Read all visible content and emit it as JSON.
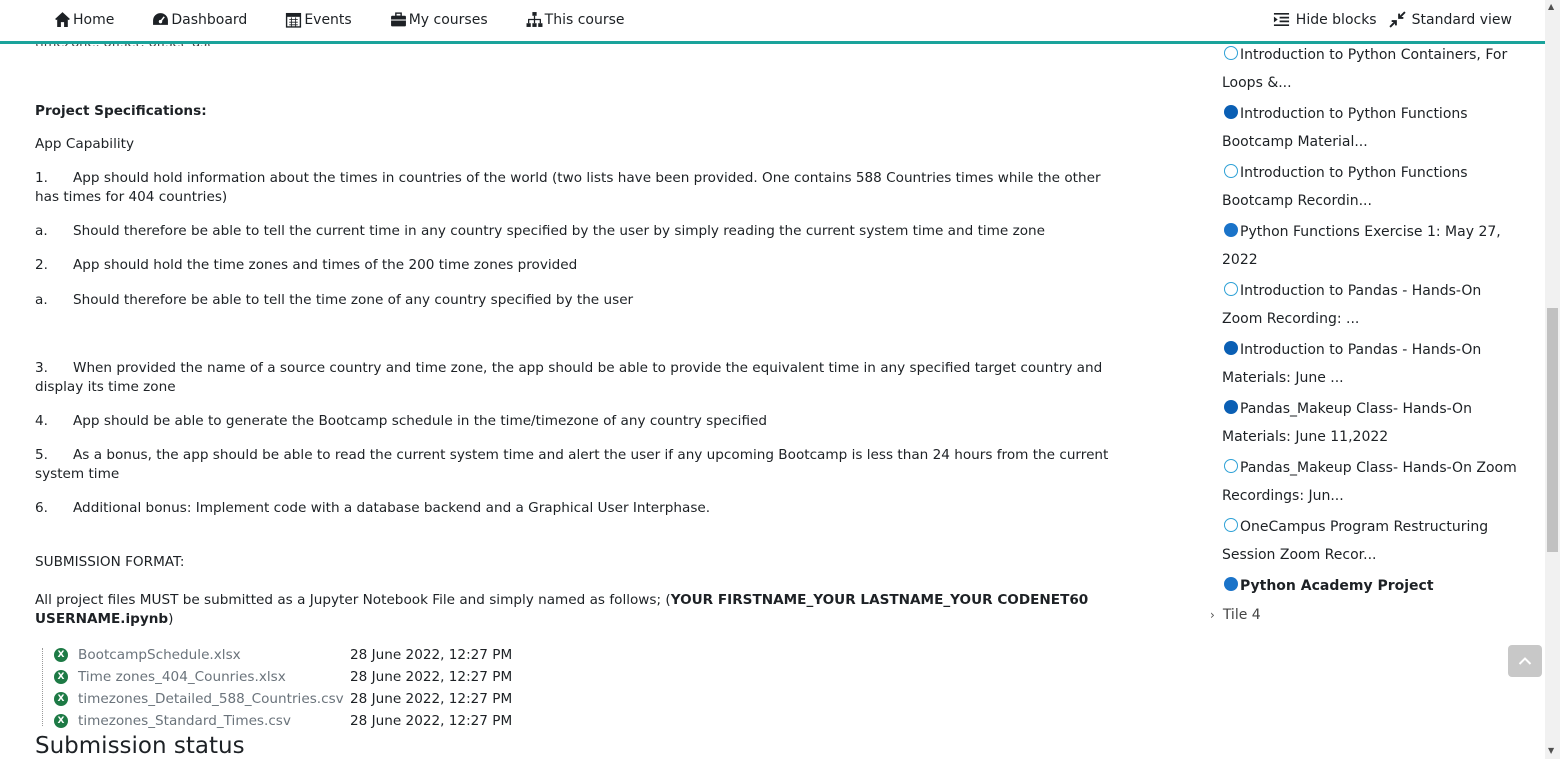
{
  "nav": {
    "home": "Home",
    "dashboard": "Dashboard",
    "events": "Events",
    "my_courses": "My courses",
    "this_course": "This course",
    "hide_blocks": "Hide blocks",
    "standard_view": "Standard view"
  },
  "content": {
    "cut_text": "timezone, offset, offset_dst",
    "spec_heading": "Project Specifications:",
    "app_capability": "App Capability",
    "items": [
      {
        "num": "1.",
        "text": "App should hold information about the times in countries of the world (two lists have been provided. One contains 588 Countries times while the other has times for 404 countries)"
      },
      {
        "num": "a.",
        "text": "Should therefore be able to tell the current time in any country specified by the user by simply reading the current system time and time zone"
      },
      {
        "num": "2.",
        "text": "App should hold the time zones and times of the 200 time zones provided"
      },
      {
        "num": "a.",
        "text": "Should therefore be able to tell the time zone of any country specified by the user"
      },
      {
        "num": "3.",
        "text": "When provided the name of a source country and time zone, the app should be able to provide the equivalent time in any specified target country and display its time zone"
      },
      {
        "num": "4.",
        "text": "App should be able to generate the Bootcamp schedule in the time/timezone of any country specified"
      },
      {
        "num": "5.",
        "text": "As a bonus, the app should be able to read the current system time and alert the user if any upcoming Bootcamp is less than 24 hours from the current system time"
      },
      {
        "num": "6.",
        "text": "Additional bonus: Implement code with a database backend and a Graphical User Interphase."
      }
    ],
    "submission_heading": "SUBMISSION FORMAT:",
    "submission_text_pre": "All project files MUST be submitted as a Jupyter Notebook File and simply named as follows; (",
    "submission_text_bold": "YOUR FIRSTNAME_YOUR LASTNAME_YOUR CODENET60 USERNAME.ipynb",
    "submission_text_post": ")",
    "files": [
      {
        "name": "BootcampSchedule.xlsx",
        "date": "28 June 2022, 12:27 PM"
      },
      {
        "name": "Time zones_404_Counries.xlsx",
        "date": "28 June 2022, 12:27 PM"
      },
      {
        "name": "timezones_Detailed_588_Countries.csv",
        "date": "28 June 2022, 12:27 PM"
      },
      {
        "name": "timezones_Standard_Times.csv",
        "date": "28 June 2022, 12:27 PM"
      }
    ],
    "submission_status": "Submission status"
  },
  "sidebar": {
    "activities": [
      {
        "type": "url",
        "line1": "Introduction to Python Containers, For",
        "line2": "Loops &..."
      },
      {
        "type": "folder",
        "line1": "Introduction to Python Functions",
        "line2": "Bootcamp Material..."
      },
      {
        "type": "url",
        "line1": "Introduction to Python Functions",
        "line2": "Bootcamp Recordin..."
      },
      {
        "type": "assign",
        "line1": "Python Functions Exercise 1: May 27,",
        "line2": "2022"
      },
      {
        "type": "url",
        "line1": "Introduction to Pandas - Hands-On",
        "line2": "Zoom Recording: ..."
      },
      {
        "type": "folder",
        "line1": "Introduction to Pandas - Hands-On",
        "line2": "Materials: June ..."
      },
      {
        "type": "folder",
        "line1": "Pandas_Makeup Class- Hands-On",
        "line2": "Materials: June 11,2022"
      },
      {
        "type": "url",
        "line1": "Pandas_Makeup Class- Hands-On Zoom",
        "line2": "Recordings: Jun..."
      },
      {
        "type": "url",
        "line1": "OneCampus Program Restructuring",
        "line2": "Session Zoom Recor..."
      },
      {
        "type": "assign",
        "line1": "Python Academy Project",
        "line2": ""
      }
    ],
    "tile": "Tile 4"
  },
  "colors": {
    "accent": "#1aa39b",
    "excel_green": "#1d7a45",
    "link_grey": "#6a737b"
  }
}
